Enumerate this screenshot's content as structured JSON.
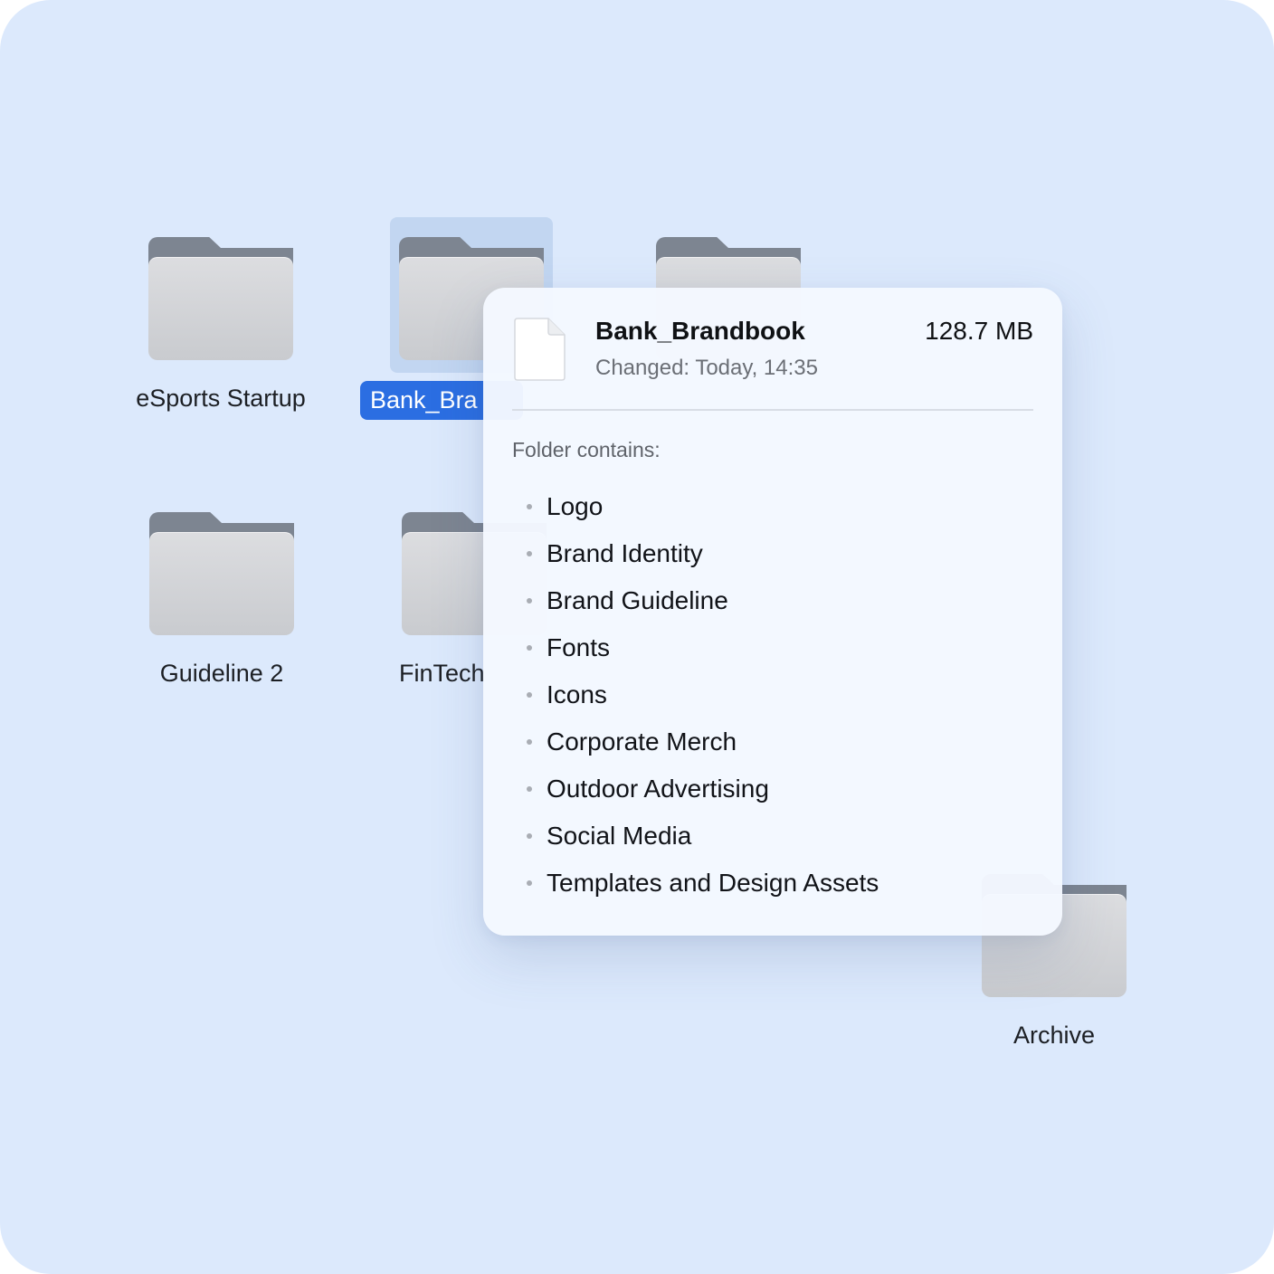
{
  "folders": [
    {
      "name": "eSports Startup"
    },
    {
      "name": "Bank_Brandbook"
    },
    {
      "name": "Guideline 2"
    },
    {
      "name": "FinTech"
    },
    {
      "name": "Archive"
    }
  ],
  "selected": {
    "label_visible": "Bank_Bra"
  },
  "info_popover": {
    "title": "Bank_Brandbook",
    "size": "128.7 MB",
    "changed": "Changed: Today, 14:35",
    "contains_label": "Folder contains:",
    "items": [
      "Logo",
      "Brand Identity",
      "Brand Guideline",
      "Fonts",
      "Icons",
      "Corporate Merch",
      "Outdoor Advertising",
      "Social Media",
      "Templates and Design Assets"
    ]
  },
  "colors": {
    "background": "#dce9fc",
    "selection": "#2b6ee2",
    "folder_tab": "#7d8591",
    "folder_body": "#d3d5d9"
  },
  "icons": {
    "folder": "folder-icon",
    "document": "document-icon"
  }
}
